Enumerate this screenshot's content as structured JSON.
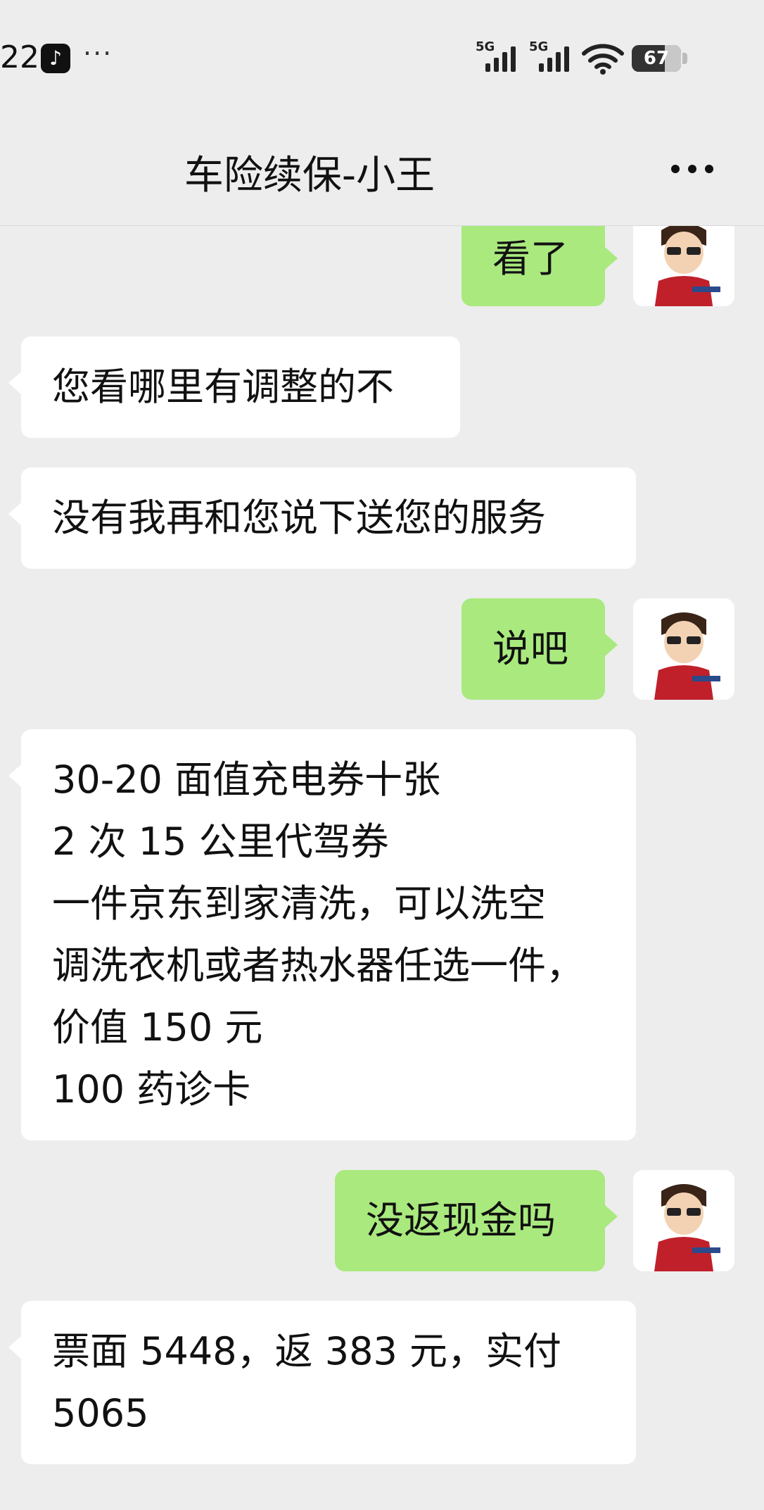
{
  "status_bar": {
    "time": "22",
    "tiktok_glyph": "♪",
    "more": "···",
    "network_1": "5G",
    "network_2": "5G",
    "battery": "67",
    "battery_level": 0.67
  },
  "header": {
    "title": "车险续保-小王",
    "more_icon": "ellipsis-icon"
  },
  "messages": [
    {
      "side": "out",
      "lines": [
        "看了"
      ]
    },
    {
      "side": "in",
      "lines": [
        "您看哪里有调整的不"
      ]
    },
    {
      "side": "in",
      "lines": [
        "没有我再和您说下送您的服务"
      ]
    },
    {
      "side": "out",
      "lines": [
        "说吧"
      ]
    },
    {
      "side": "in",
      "lines": [
        "30-20 面值充电券十张",
        "2 次 15 公里代驾券",
        "一件京东到家清洗，可以洗空",
        "调洗衣机或者热水器任选一件，",
        "价值 150 元",
        "100 药诊卡"
      ]
    },
    {
      "side": "out",
      "lines": [
        "没返现金吗"
      ]
    },
    {
      "side": "in",
      "lines": [
        "票面 5448，返 383 元，实付",
        "5065"
      ]
    }
  ],
  "colors": {
    "background": "#ededed",
    "outgoing_bubble": "#a9e97e",
    "incoming_bubble": "#ffffff"
  }
}
